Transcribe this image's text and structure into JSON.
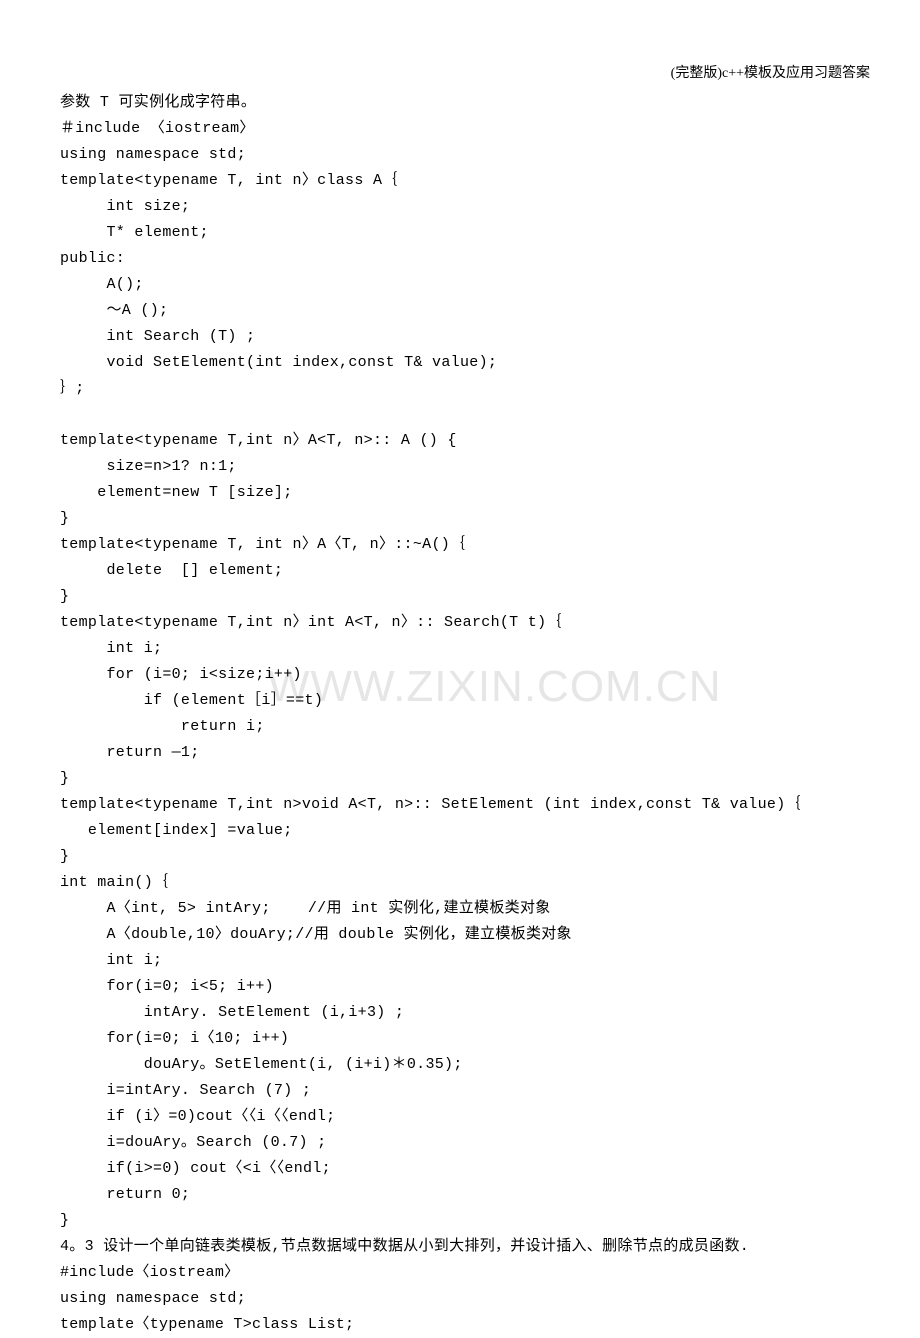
{
  "header": {
    "title": "(完整版)c++模板及应用习题答案"
  },
  "watermark": "WWW.ZIXIN.COM.CN",
  "code": {
    "line01": "参数 T 可实例化成字符串。",
    "line02": "＃include 〈iostream〉",
    "line03": "using namespace std;",
    "line04": "template<typename T, int n〉class A｛",
    "line05": "     int size;",
    "line06": "     T* element;",
    "line07": "public:",
    "line08": "     A();",
    "line09": "     ～A ();",
    "line10": "     int Search (T) ;",
    "line11": "     void SetElement(int index,const T& value);",
    "line12": "｝;",
    "line13": "",
    "line14": "template<typename T,int n〉A<T, n>:: A () {",
    "line15": "     size=n>1? n:1;",
    "line16": "    element=new T [size];",
    "line17": "}",
    "line18": "template<typename T, int n〉A〈T, n〉::~A()｛",
    "line19": "     delete  [] element;",
    "line20": "}",
    "line21": "template<typename T,int n〉int A<T, n〉:: Search(T t)｛",
    "line22": "     int i;",
    "line23": "     for (i=0; i<size;i++)",
    "line24": "         if (element［i］==t)",
    "line25": "             return i;",
    "line26": "     return —1;",
    "line27": "}",
    "line28": "template<typename T,int n>void A<T, n>:: SetElement (int index,const T& value)｛",
    "line29": "   element[index] =value;",
    "line30": "}",
    "line31": "int main()｛",
    "line32": "     A〈int, 5> intAry;    //用 int 实例化,建立模板类对象",
    "line33": "     A〈double,10〉douAry;//用 double 实例化，建立模板类对象",
    "line34": "     int i;",
    "line35": "     for(i=0; i<5; i++)",
    "line36": "         intAry. SetElement (i,i+3) ;",
    "line37": "     for(i=0; i〈10; i++)",
    "line38": "         douAry。SetElement(i, (i+i)＊0.35);",
    "line39": "     i=intAry. Search (7) ;",
    "line40": "     if (i〉=0)cout〈〈i〈〈endl;",
    "line41": "     i=douAry。Search (0.7) ;",
    "line42": "     if(i>=0) cout〈<i〈〈endl;",
    "line43": "     return 0;",
    "line44": "}",
    "line45": "4。3 设计一个单向链表类模板,节点数据域中数据从小到大排列，并设计插入、删除节点的成员函数.",
    "line46": "#include〈iostream〉",
    "line47": "using namespace std;",
    "line48": "template〈typename T>class List;"
  }
}
